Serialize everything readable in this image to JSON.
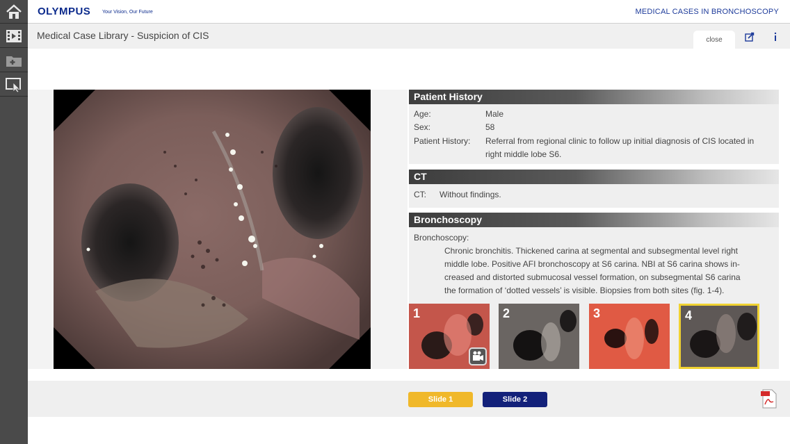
{
  "header": {
    "logo_word": "OLYMPUS",
    "logo_tagline": "Your Vision, Our Future",
    "section_title": "MEDICAL CASES IN BRONCHOSCOPY"
  },
  "rail": {
    "items": [
      {
        "icon": "home-icon"
      },
      {
        "icon": "video-library-icon"
      },
      {
        "icon": "add-folder-icon"
      },
      {
        "icon": "presentation-icon"
      }
    ]
  },
  "titlebar": {
    "title": "Medical Case Library - Suspicion of CIS",
    "close_label": "close"
  },
  "patient_history": {
    "heading": "Patient History",
    "rows": [
      {
        "label": "Age:",
        "value": "Male"
      },
      {
        "label": "Sex:",
        "value": "58"
      },
      {
        "label": "Patient History:",
        "value_line1": "Referral from regional clinic to follow up initial diagnosis of CIS located in",
        "value_line2": "right middle lobe S6."
      }
    ]
  },
  "ct": {
    "heading": "CT",
    "label": "CT:",
    "value": "Without findings."
  },
  "bronchoscopy": {
    "heading": "Bronchoscopy",
    "label": "Bronchoscopy:",
    "lines": [
      "Chronic bronchitis. Thickened carina at segmental and subsegmental level right",
      "middle lobe. Positive AFI bronchoscopy at S6 carina. NBI at S6 carina shows in-",
      "creased and distorted submucosal vessel formation, on subsegmental S6 carina",
      "the formation of ‘dotted vessels’ is visible. Biopsies from both sites (fig. 1-4)."
    ]
  },
  "thumbnails": [
    {
      "num": "1",
      "color": "#c8554a",
      "has_video": true
    },
    {
      "num": "2",
      "color": "#6e6a66",
      "has_video": false
    },
    {
      "num": "3",
      "color": "#d95a45",
      "has_video": false
    },
    {
      "num": "4",
      "color": "#5f5a58",
      "has_video": false,
      "selected": true
    }
  ],
  "bottombar": {
    "slide1_label": "Slide 1",
    "slide2_label": "Slide 2"
  },
  "colors": {
    "brand_blue": "#0b2a8c",
    "slide1": "#f0b82a",
    "slide2": "#13217a",
    "selection": "#f0d232"
  }
}
